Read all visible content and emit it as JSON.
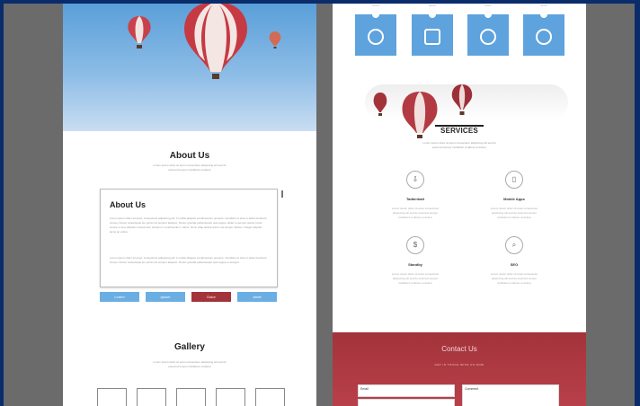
{
  "colors": {
    "frame": "#0a2c6b",
    "backdrop": "#6b6b6b",
    "accent_blue": "#5ea3dd",
    "accent_red": "#a3333a",
    "sky": "#8cbce6"
  },
  "left_page": {
    "hero": {
      "balloons": [
        "balloon-small",
        "balloon-large",
        "balloon-tiny"
      ]
    },
    "about": {
      "heading": "About Us",
      "intro_lines": [
        "Lorem ipsum dolor sit amet consectetur adipiscing elit sed do",
        "eiusmod tempor incididunt ut labore"
      ],
      "box_title": "About Us",
      "paragraph_1": "Lorem ipsum dolor sit amet, consectetur adipiscing elit. In mollis aliquam condimentum posuere. Curabitur ut ante in tellus hendrerit cursus. Donec scelerisque leo porta nisi semper aliquam. Donec gravida pellentesque quis augue. Etiam a semper auctor porta ornare in sed. Aliquam massa sem tempus in condimentum, varius. Nunc vitae lacinia ipsum vel tempor ultrices. Integer aliquam lacus ac varius.",
      "paragraph_2": "Lorem ipsum dolor sit amet, consectetur adipiscing elit. In mollis aliquam condimentum posuere. Curabitur ut ante in tellus hendrerit cursus. Donec scelerisque leo porta nisi semper aliquam. Donec gravida pellentesque quis augue ut semper."
    },
    "tabs": [
      {
        "label": "Lorem",
        "color": "#6aaee3"
      },
      {
        "label": "Ipsum",
        "color": "#6aaee3"
      },
      {
        "label": "Dolor",
        "color": "#a3333a"
      },
      {
        "label": "Amet",
        "color": "#6aaee3"
      }
    ],
    "gallery": {
      "heading": "Gallery",
      "intro_lines": [
        "Lorem ipsum dolor sit amet consectetur adipiscing elit sed do",
        "eiusmod tempor incididunt ut labore"
      ],
      "thumb_count": 5
    }
  },
  "right_page": {
    "top_icons": [
      {
        "label": "Lorem",
        "icon": "smiley-icon"
      },
      {
        "label": "Ipsum",
        "icon": "briefcase-icon"
      },
      {
        "label": "Dolor",
        "icon": "robot-icon"
      },
      {
        "label": "Amet",
        "icon": "puzzle-icon"
      }
    ],
    "services": {
      "heading": "SERVICES",
      "intro_lines": [
        "Lorem ipsum dolor sit amet consectetur adipiscing elit sed do",
        "eiusmod tempor incididunt ut labore et dolore"
      ],
      "items": [
        {
          "title": "Tadtenhalt",
          "icon": "download-icon",
          "glyph": "⇩",
          "lines": [
            "Lorem ipsum dolor sit amet consectetur",
            "adipiscing elit sed do eiusmod tempor",
            "incididunt ut labore et dolore"
          ]
        },
        {
          "title": "Mobile Apps",
          "icon": "phone-icon",
          "glyph": "▯",
          "lines": [
            "Lorem ipsum dolor sit amet consectetur",
            "adipiscing elit sed do eiusmod tempor",
            "incididunt ut labore et dolore"
          ]
        },
        {
          "title": "Standby",
          "icon": "dollar-icon",
          "glyph": "$",
          "lines": [
            "Lorem ipsum dolor sit amet consectetur",
            "adipiscing elit sed do eiusmod tempor",
            "incididunt ut labore et dolore"
          ]
        },
        {
          "title": "SEO",
          "icon": "search-icon",
          "glyph": "⌕",
          "lines": [
            "Lorem ipsum dolor sit amet consectetur",
            "adipiscing elit sed do eiusmod tempor",
            "incididunt ut labore et dolore"
          ]
        }
      ]
    },
    "contact": {
      "heading": "Contact Us",
      "subheading": "GET IN TOUCH WITH US NOW",
      "email_placeholder": "Email",
      "comment_placeholder": "Comment"
    }
  }
}
